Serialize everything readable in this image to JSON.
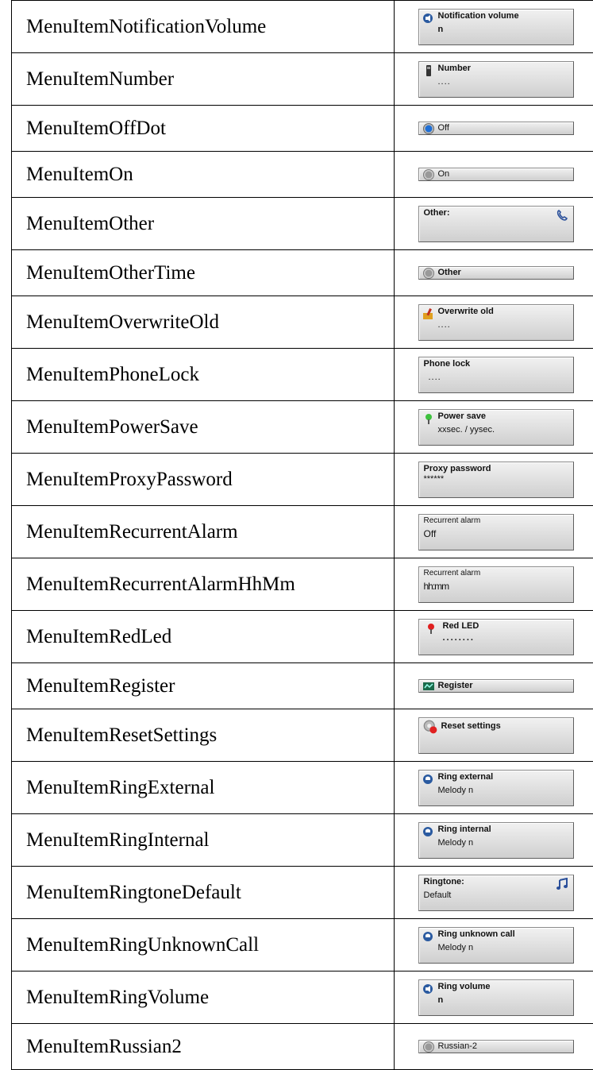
{
  "rows": [
    {
      "name": "MenuItemNotificationVolume",
      "line1": "Notification volume",
      "line2": "n",
      "icon": "speaker-icon"
    },
    {
      "name": "MenuItemNumber",
      "line1": "Number",
      "line2": "....",
      "icon": "handset-icon"
    },
    {
      "name": "MenuItemOffDot",
      "line1": "Off",
      "icon": "radio-selected-icon"
    },
    {
      "name": "MenuItemOn",
      "line1": "On",
      "icon": "radio-unselected-icon"
    },
    {
      "name": "MenuItemOther",
      "line1": "Other:",
      "icon": "phone-icon"
    },
    {
      "name": "MenuItemOtherTime",
      "line1": "Other",
      "icon": "radio-unselected-icon"
    },
    {
      "name": "MenuItemOverwriteOld",
      "line1": "Overwrite old",
      "line2": "....",
      "icon": "overwrite-icon"
    },
    {
      "name": "MenuItemPhoneLock",
      "line1": "Phone lock",
      "line2": "...."
    },
    {
      "name": "MenuItemPowerSave",
      "line1": "Power save",
      "line2": "xxsec. / yysec.",
      "icon": "green-led-icon"
    },
    {
      "name": "MenuItemProxyPassword",
      "line1": "Proxy password",
      "line2": "******"
    },
    {
      "name": "MenuItemRecurrentAlarm",
      "line1": "Recurrent alarm",
      "line2": "Off"
    },
    {
      "name": "MenuItemRecurrentAlarmHhMm",
      "line1": "Recurrent alarm",
      "line2": "hh:mm"
    },
    {
      "name": "MenuItemRedLed",
      "line1": "Red LED",
      "line2": "........",
      "icon": "red-led-icon"
    },
    {
      "name": "MenuItemRegister",
      "line1": "Register",
      "icon": "register-icon"
    },
    {
      "name": "MenuItemResetSettings",
      "line1": "Reset settings",
      "icon": "reset-gear-icon"
    },
    {
      "name": "MenuItemRingExternal",
      "line1": "Ring external",
      "line2": "Melody n",
      "icon": "ring-icon"
    },
    {
      "name": "MenuItemRingInternal",
      "line1": "Ring internal",
      "line2": "Melody n",
      "icon": "ring-icon"
    },
    {
      "name": "MenuItemRingtoneDefault",
      "line1": "Ringtone:",
      "line2": "Default",
      "icon": "music-note-icon"
    },
    {
      "name": "MenuItemRingUnknownCall",
      "line1": "Ring unknown call",
      "line2": "Melody n",
      "icon": "ring-icon"
    },
    {
      "name": "MenuItemRingVolume",
      "line1": "Ring volume",
      "line2": "n",
      "icon": "speaker-icon"
    },
    {
      "name": "MenuItemRussian2",
      "line1": "Russian-2",
      "icon": "radio-unselected-icon"
    }
  ]
}
